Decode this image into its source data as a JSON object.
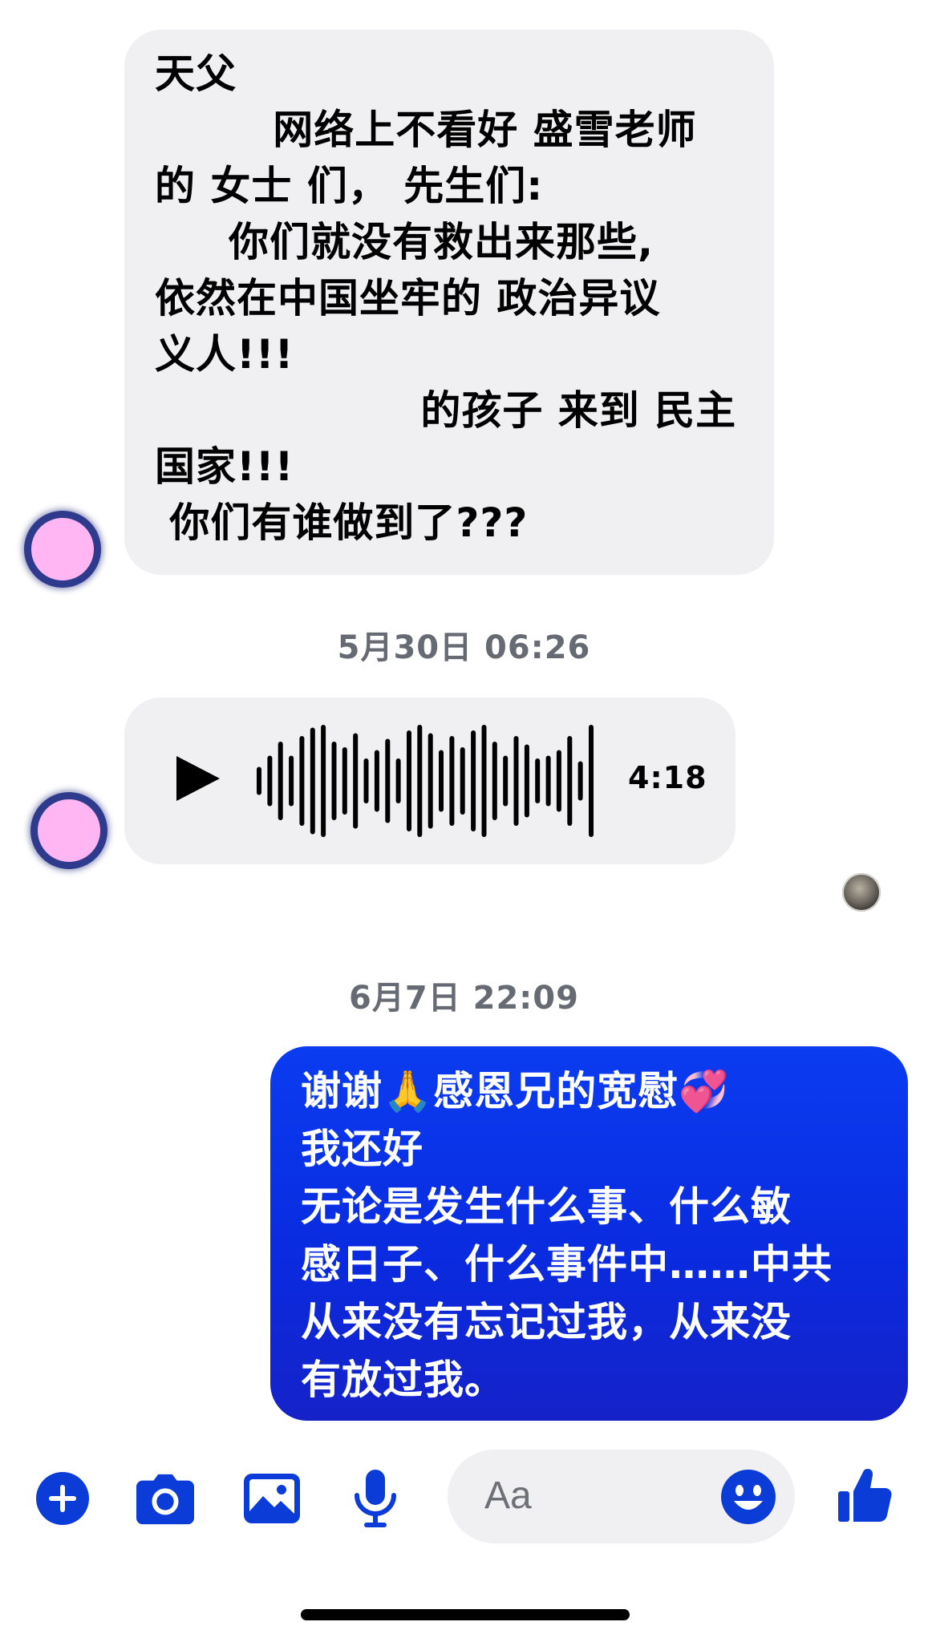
{
  "conversation": {
    "messages": [
      {
        "direction": "incoming",
        "text": "天父\n        网络上不看好 盛雪老师\n的 女士 们， 先生们:\n     你们就没有救出来那些,\n依然在中国坐牢的 政治异议\n义人!!!\n                  的孩子 来到 民主\n国家!!!\n 你们有谁做到了???"
      },
      {
        "type": "timestamp",
        "text": "5月30日 06:26"
      },
      {
        "direction": "incoming",
        "type": "voice",
        "duration": "4:18",
        "waveform_levels": [
          0.25,
          0.45,
          0.7,
          0.45,
          0.8,
          0.95,
          1.0,
          0.7,
          0.6,
          0.85,
          0.4,
          0.55,
          0.75,
          0.4,
          0.9,
          1.0,
          0.85,
          0.55,
          0.8,
          0.6,
          0.9,
          1.0,
          0.7,
          0.45,
          0.8,
          0.65,
          0.4,
          0.45,
          0.55,
          0.8,
          0.35,
          1.0
        ]
      },
      {
        "type": "timestamp",
        "text": "6月7日 22:09"
      },
      {
        "direction": "outgoing",
        "text": "谢谢🙏感恩兄的宽慰💞\n我还好\n无论是发生什么事、什么敏\n感日子、什么事件中……中共\n从来没有忘记过我，从来没\n有放过我。"
      }
    ]
  },
  "composer": {
    "placeholder": "Aa",
    "icons": [
      "plus-icon",
      "camera-icon",
      "image-icon",
      "microphone-icon",
      "emoji-icon",
      "thumbs-up-icon"
    ]
  },
  "colors": {
    "accent": "#0a2be0",
    "icon_blue": "#0b3cd8",
    "incoming_bubble": "#f0f0f3",
    "timestamp_gray": "#666a72"
  }
}
